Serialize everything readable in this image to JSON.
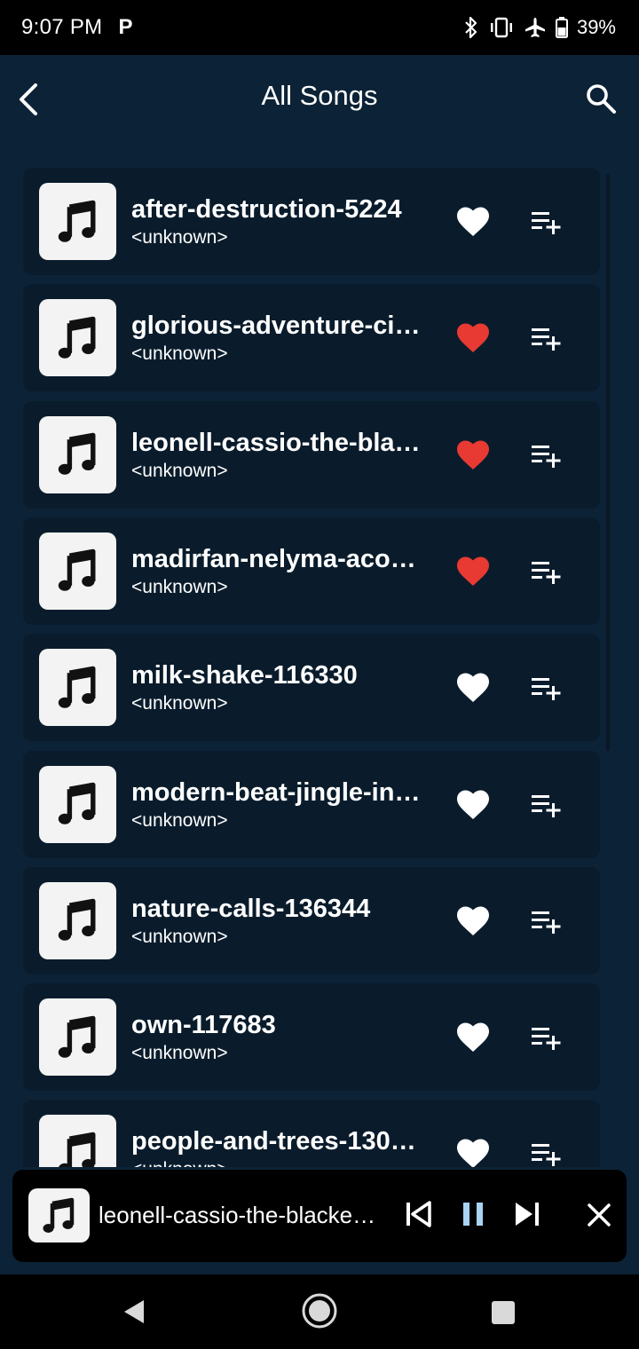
{
  "status": {
    "time": "9:07 PM",
    "carrier_icon_label": "P",
    "battery_percent": "39%",
    "icons": [
      "bluetooth-icon",
      "vibrate-icon",
      "airplane-icon",
      "battery-icon"
    ]
  },
  "header": {
    "title": "All Songs",
    "back_icon": "back-arrow-icon",
    "search_icon": "search-icon"
  },
  "songs": [
    {
      "title": "after-destruction-5224",
      "artist": "<unknown>",
      "favorite": false
    },
    {
      "title": "glorious-adventure-ci…",
      "artist": "<unknown>",
      "favorite": true
    },
    {
      "title": "leonell-cassio-the-bla…",
      "artist": "<unknown>",
      "favorite": true
    },
    {
      "title": "madirfan-nelyma-aco…",
      "artist": "<unknown>",
      "favorite": true
    },
    {
      "title": "milk-shake-116330",
      "artist": "<unknown>",
      "favorite": false
    },
    {
      "title": "modern-beat-jingle-in…",
      "artist": "<unknown>",
      "favorite": false
    },
    {
      "title": "nature-calls-136344",
      "artist": "<unknown>",
      "favorite": false
    },
    {
      "title": "own-117683",
      "artist": "<unknown>",
      "favorite": false
    },
    {
      "title": "people-and-trees-130…",
      "artist": "<unknown>",
      "favorite": false
    }
  ],
  "now_playing": {
    "title": "leonell-cassio-the-blacke…",
    "controls": [
      "previous-icon",
      "pause-icon",
      "next-icon",
      "close-icon"
    ]
  },
  "colors": {
    "background": "#0c2236",
    "row": "#0a1c2c",
    "favorite_active": "#e83a32",
    "favorite_inactive": "#ffffff",
    "pause_accent": "#a9d3f5"
  }
}
